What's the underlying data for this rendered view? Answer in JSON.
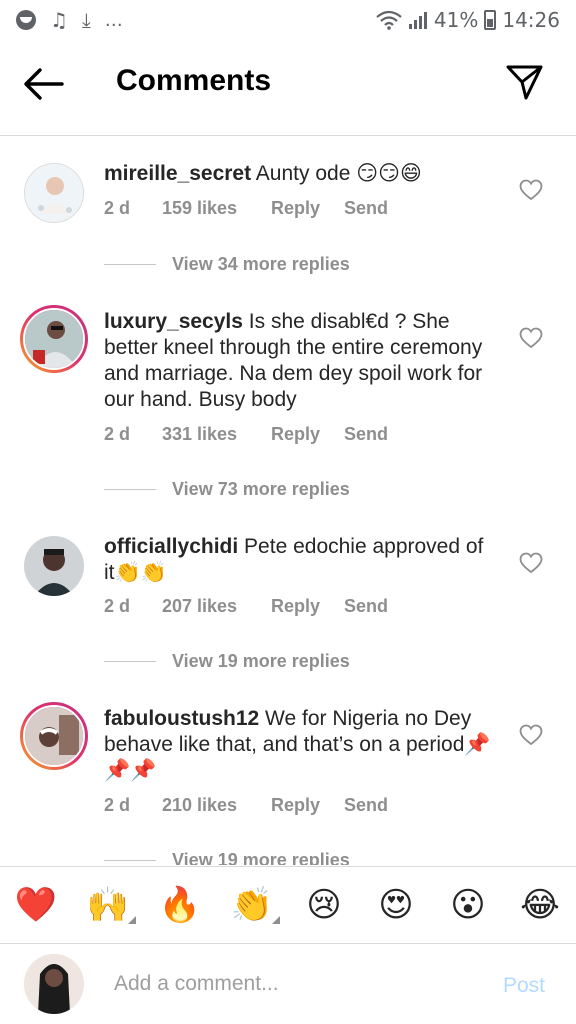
{
  "status_bar": {
    "battery": "41%",
    "time": "14:26",
    "more": "…"
  },
  "header": {
    "title": "Comments",
    "back_icon": "arrow-left-icon",
    "send_icon": "paper-plane-icon"
  },
  "comments": [
    {
      "username": "mireille_secret",
      "text": "Aunty ode 😏😏😄",
      "time": "2 d",
      "likes": "159 likes",
      "reply": "Reply",
      "send": "Send",
      "view_replies": "View 34 more replies"
    },
    {
      "username": "luxury_secyls",
      "text": "Is she disabl€d ? She better kneel through the entire ceremony and marriage.  Na dem dey spoil work for our hand. Busy body",
      "time": "2 d",
      "likes": "331 likes",
      "reply": "Reply",
      "send": "Send",
      "view_replies": "View 73 more replies"
    },
    {
      "username": "officiallychidi",
      "text": "Pete edochie approved of it👏👏",
      "time": "2 d",
      "likes": "207 likes",
      "reply": "Reply",
      "send": "Send",
      "view_replies": "View 19 more replies"
    },
    {
      "username": "fabuloustush12",
      "text": "We for Nigeria no Dey behave like that, and that’s on a period📌📌📌",
      "time": "2 d",
      "likes": "210 likes",
      "reply": "Reply",
      "send": "Send",
      "view_replies": "View 19 more replies"
    }
  ],
  "emoji_bar": [
    "❤️",
    "🙌",
    "🔥",
    "👏",
    "😢",
    "😍",
    "😮",
    "😂"
  ],
  "composer": {
    "placeholder": "Add a comment...",
    "post_label": "Post"
  },
  "colors": {
    "muted_text": "#8e8e8e",
    "post_disabled": "#b3dbff",
    "story_ring": "#e1306c"
  }
}
